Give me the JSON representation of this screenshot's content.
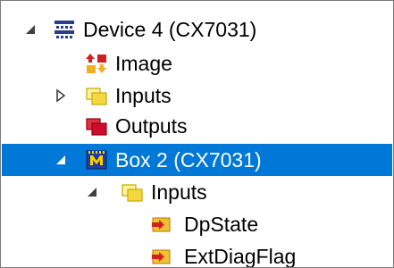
{
  "tree": {
    "nodes": [
      {
        "label": "Device 4 (CX7031)",
        "expander": "expanded",
        "icon": "device-network-icon",
        "selected": false
      },
      {
        "label": "Image",
        "expander": "none",
        "icon": "image-icon",
        "selected": false
      },
      {
        "label": "Inputs",
        "expander": "collapsed",
        "icon": "inputs-folder-icon",
        "selected": false
      },
      {
        "label": "Outputs",
        "expander": "none",
        "icon": "outputs-folder-icon",
        "selected": false
      },
      {
        "label": "Box 2 (CX7031)",
        "expander": "expanded",
        "icon": "box-module-icon",
        "selected": true
      },
      {
        "label": "Inputs",
        "expander": "expanded",
        "icon": "inputs-folder-icon",
        "selected": false
      },
      {
        "label": "DpState",
        "expander": "none",
        "icon": "input-variable-icon",
        "selected": false
      },
      {
        "label": "ExtDiagFlag",
        "expander": "none",
        "icon": "input-variable-icon",
        "selected": false
      }
    ]
  },
  "colors": {
    "selection": "#0078d7",
    "folder_yellow": "#f5d840",
    "outputs_red": "#c8102e",
    "variable_orange": "#f0a020"
  }
}
